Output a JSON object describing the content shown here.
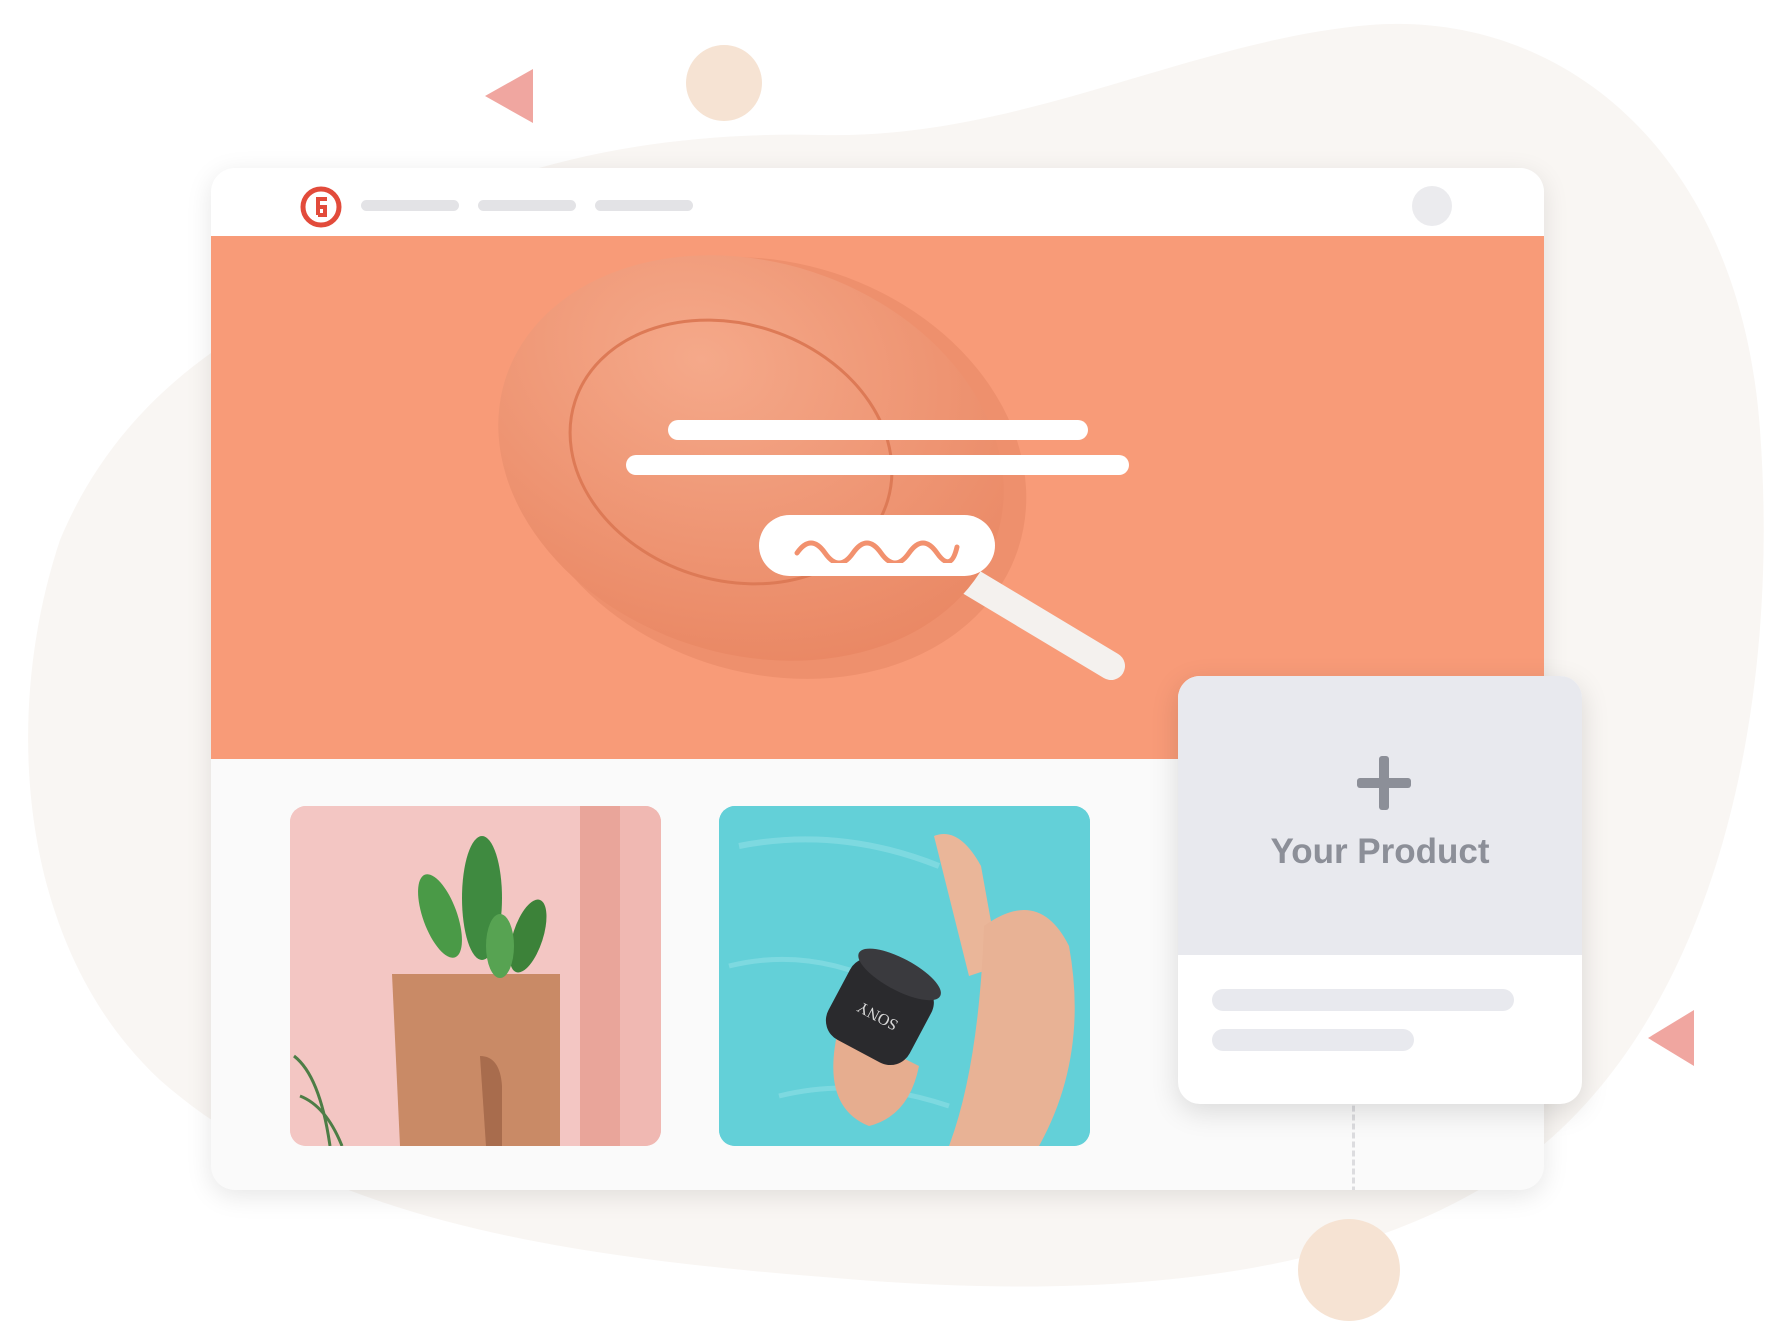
{
  "colors": {
    "background_blob": "#f9f6f3",
    "accent_orange": "#f89b78",
    "decor_peach": "#f6e3d3",
    "decor_pink": "#f0a6a0",
    "logo_red": "#e24b3b"
  },
  "header": {
    "logo_icon": "brand-logo-icon",
    "nav_items": [
      "",
      "",
      ""
    ],
    "avatar_icon": "user-avatar-icon"
  },
  "hero": {
    "heading_placeholder_lines": 2,
    "cta_icon": "wave-icon"
  },
  "products": [
    {
      "image": "cactus-plant-photo"
    },
    {
      "image": "speaker-in-hand-photo",
      "brand_text": "SONY"
    }
  ],
  "add_product": {
    "icon": "plus-icon",
    "label": "Your Product"
  }
}
